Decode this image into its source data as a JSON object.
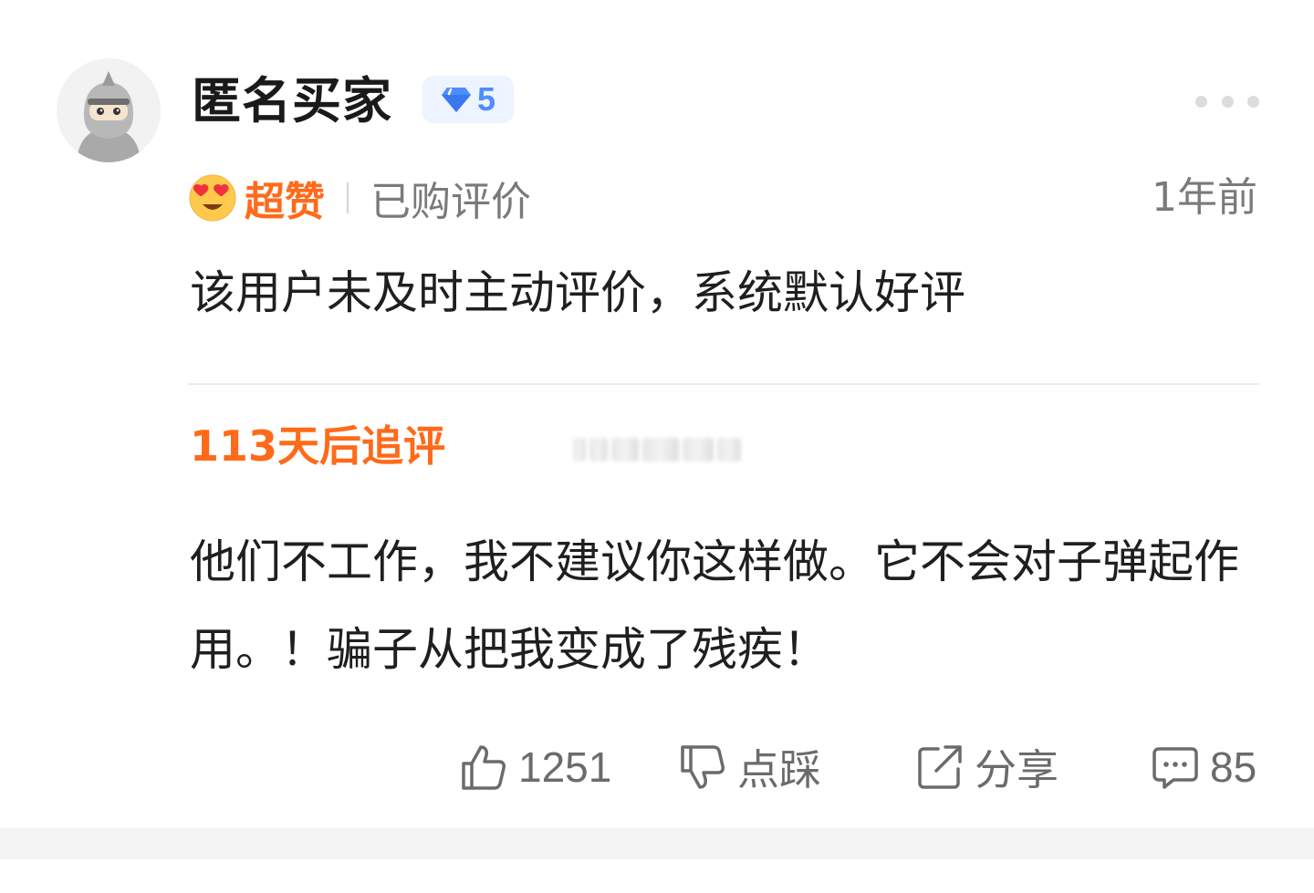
{
  "review": {
    "username": "匿名买家",
    "level": "5",
    "rating_label": "超赞",
    "purchase_tag": "已购评价",
    "time": "1年前",
    "text": "该用户未及时主动评价，系统默认好评",
    "followup_label": "113天后追评",
    "followup_text": "他们不工作，我不建议你这样做。它不会对子弹起作用。！骗子从把我变成了残疾！"
  },
  "actions": {
    "like_count": "1251",
    "dislike_label": "点踩",
    "share_label": "分享",
    "comment_count": "85"
  },
  "colors": {
    "accent_orange": "#ff6a1a",
    "badge_blue": "#4d8dff",
    "muted_text": "#7a7a7a"
  },
  "icons": {
    "level_badge": "diamond-icon",
    "rating": "heart-eyes-emoji-icon",
    "more": "more-dots-icon",
    "like": "thumbs-up-icon",
    "dislike": "thumbs-down-icon",
    "share": "share-icon",
    "comment": "comment-icon"
  }
}
